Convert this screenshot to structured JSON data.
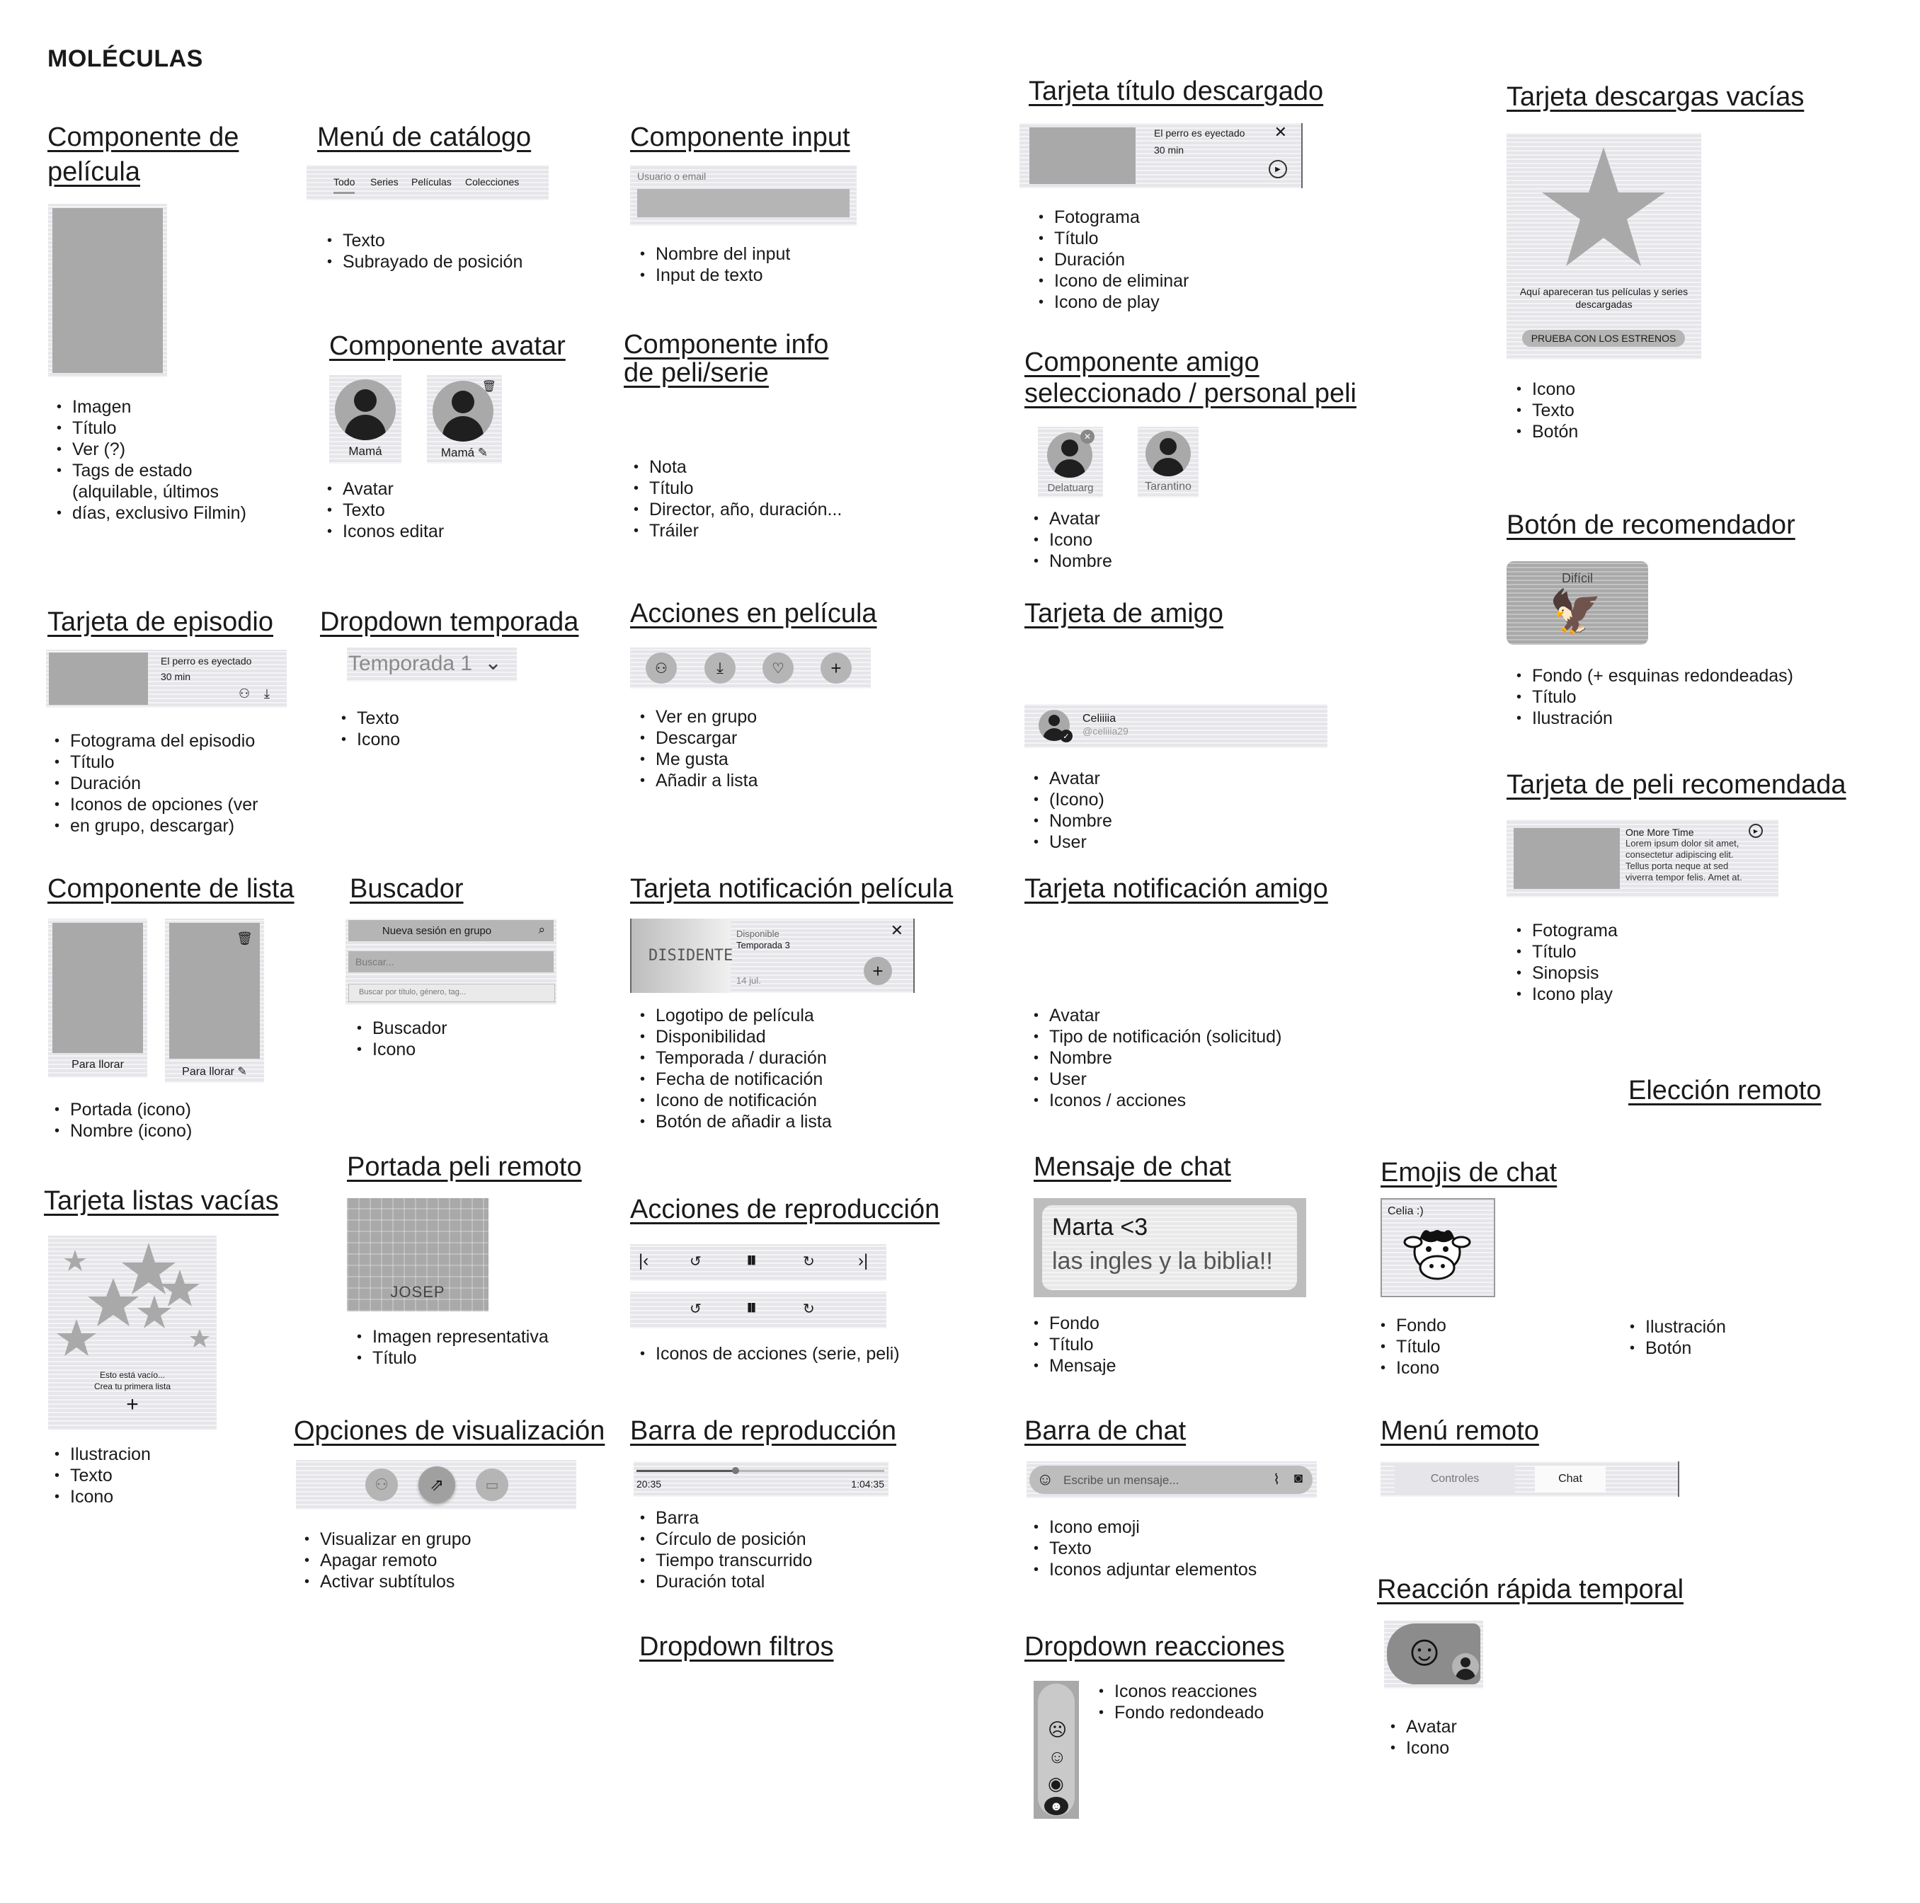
{
  "page_title": "MOLÉCULAS",
  "sections": {
    "pelicula": {
      "title_l1": "Componente de",
      "title_l2": "película",
      "bullets": [
        "Imagen",
        "Título",
        "Ver (?)",
        "Tags de estado",
        "(alquilable, últimos",
        "días, exclusivo Filmin)"
      ]
    },
    "menu_catalogo": {
      "title": "Menú de catálogo",
      "tabs": [
        "Todo",
        "Series",
        "Películas",
        "Colecciones"
      ],
      "bullets": [
        "Texto",
        "Subrayado de posición"
      ]
    },
    "input": {
      "title": "Componente input",
      "label": "Usuario o email",
      "bullets": [
        "Nombre del input",
        "Input de texto"
      ]
    },
    "titulo_descargado": {
      "title": "Tarjeta título descargado",
      "card_title": "El perro es eyectado",
      "card_duration": "30 min",
      "bullets": [
        "Fotograma",
        "Título",
        "Duración",
        "Icono de eliminar",
        "Icono de play"
      ]
    },
    "descargas_vacias": {
      "title": "Tarjeta descargas vacías",
      "text": "Aquí apareceran tus películas y series descargadas",
      "button": "PRUEBA CON LOS ESTRENOS",
      "bullets": [
        "Icono",
        "Texto",
        "Botón"
      ]
    },
    "avatar": {
      "title": "Componente avatar",
      "name1": "Mamá",
      "name2": "Mamá",
      "bullets": [
        "Avatar",
        "Texto",
        "Iconos editar"
      ]
    },
    "info_peli": {
      "title_l1": "Componente info",
      "title_l2": "de peli/serie",
      "bullets": [
        "Nota",
        "Título",
        "Director, año, duración...",
        "Tráiler"
      ]
    },
    "amigo_sel": {
      "title_l1": "Componente amigo",
      "title_l2": "seleccionado / personal peli",
      "name1": "Delatuarg",
      "name2": "Tarantino",
      "bullets": [
        "Avatar",
        "Icono",
        "Nombre"
      ]
    },
    "recomendador": {
      "title": "Botón de recomendador",
      "label": "Difícil",
      "bullets": [
        "Fondo (+ esquinas redondeadas)",
        "Título",
        "Ilustración"
      ]
    },
    "episodio": {
      "title": "Tarjeta de episodio",
      "card_title": "El perro es eyectado",
      "card_duration": "30 min",
      "bullets": [
        "Fotograma del episodio",
        "Título",
        "Duración",
        "Iconos de opciones (ver",
        "en grupo, descargar)"
      ]
    },
    "dropdown_temporada": {
      "title": "Dropdown temporada",
      "value": "Temporada 1",
      "bullets": [
        "Texto",
        "Icono"
      ]
    },
    "acciones_pelicula": {
      "title": "Acciones en película",
      "bullets": [
        "Ver en grupo",
        "Descargar",
        "Me gusta",
        "Añadir a lista"
      ]
    },
    "tarjeta_amigo": {
      "title": "Tarjeta de amigo",
      "name": "Celiiiia",
      "user": "@celiiia29",
      "bullets": [
        "Avatar",
        "(Icono)",
        "Nombre",
        "User"
      ]
    },
    "peli_recomendada": {
      "title": "Tarjeta de peli recomendada",
      "card_title": "One More Time",
      "synopsis": "Lorem ipsum dolor sit amet, consectetur adipiscing elit. Tellus porta neque at sed viverra tempor felis. Amet at.",
      "bullets": [
        "Fotograma",
        "Título",
        "Sinopsis",
        "Icono play"
      ]
    },
    "lista": {
      "title": "Componente de lista",
      "name1": "Para llorar",
      "name2": "Para llorar",
      "bullets": [
        "Portada (icono)",
        "Nombre (icono)"
      ]
    },
    "buscador": {
      "title": "Buscador",
      "bar1": "Nueva sesión en grupo",
      "bar2": "Buscar...",
      "bar3": "Buscar por título, género, tag...",
      "bullets": [
        "Buscador",
        "Icono"
      ]
    },
    "notif_pelicula": {
      "title": "Tarjeta notificación película",
      "logo": "DISIDENTE",
      "status": "Disponible",
      "season": "Temporada 3",
      "date": "14 jul.",
      "bullets": [
        "Logotipo de película",
        "Disponibilidad",
        "Temporada / duración",
        "Fecha de notificación",
        "Icono de notificación",
        "Botón de añadir a lista"
      ]
    },
    "notif_amigo": {
      "title": "Tarjeta notificación amigo",
      "bullets": [
        "Avatar",
        "Tipo de notificación (solicitud)",
        "Nombre",
        "User",
        "Iconos / acciones"
      ]
    },
    "eleccion_remoto": {
      "title": "Elección remoto",
      "bullets": [
        "Ilustración",
        "Botón"
      ]
    },
    "listas_vacias": {
      "title": "Tarjeta listas vacías",
      "text1": "Esto está vacío...",
      "text2": "Crea tu primera lista",
      "bullets": [
        "Ilustracion",
        "Texto",
        "Icono"
      ]
    },
    "portada_remoto": {
      "title": "Portada peli remoto",
      "cover_text": "JOSEP",
      "bullets": [
        "Imagen representativa",
        "Título"
      ]
    },
    "acciones_reproduccion": {
      "title": "Acciones de reproducción",
      "bullets": [
        "Iconos de acciones (serie, peli)"
      ]
    },
    "mensaje_chat": {
      "title": "Mensaje de chat",
      "name": "Marta <3",
      "message": "las ingles y la biblia!!",
      "bullets": [
        "Fondo",
        "Título",
        "Mensaje"
      ]
    },
    "emojis_chat": {
      "title": "Emojis de chat",
      "label": "Celia :)",
      "bullets": [
        "Fondo",
        "Título",
        "Icono"
      ]
    },
    "visualizacion": {
      "title": "Opciones de visualización",
      "bullets": [
        "Visualizar en grupo",
        "Apagar remoto",
        "Activar subtítulos"
      ]
    },
    "barra_reproduccion": {
      "title": "Barra de reproducción",
      "elapsed": "20:35",
      "total": "1:04:35",
      "progress": 0.4,
      "bullets": [
        "Barra",
        "Círculo de posición",
        "Tiempo transcurrido",
        "Duración total"
      ]
    },
    "barra_chat": {
      "title": "Barra de chat",
      "placeholder": "Escribe un mensaje...",
      "bullets": [
        "Icono emoji",
        "Texto",
        "Iconos adjuntar elementos"
      ]
    },
    "menu_remoto": {
      "title": "Menú remoto",
      "tabs": [
        "Controles",
        "Chat"
      ]
    },
    "reaccion_rapida": {
      "title": "Reacción rápida temporal",
      "bullets": [
        "Avatar",
        "Icono"
      ]
    },
    "dropdown_filtros": {
      "title": "Dropdown filtros"
    },
    "dropdown_reacciones": {
      "title": "Dropdown reacciones",
      "bullets": [
        "Iconos reacciones",
        "Fondo redondeado"
      ]
    }
  },
  "colors": {
    "placeholder_gray": "#a9a9a9",
    "stripe_bg": "#e6e6ea",
    "text": "#1a1a1a"
  }
}
